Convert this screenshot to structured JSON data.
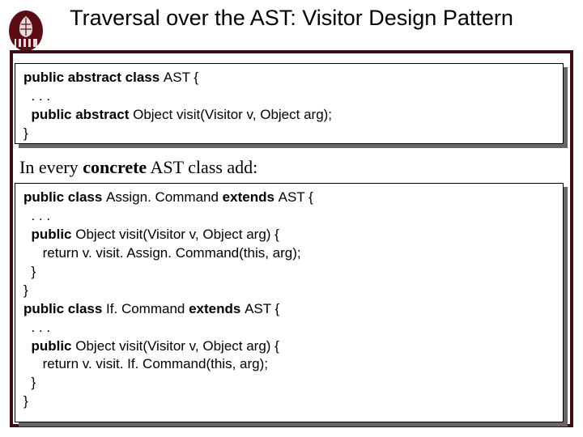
{
  "title": "Traversal over the AST: Visitor Design Pattern",
  "code1": {
    "l1a": "public abstract class ",
    "l1b": "AST {",
    "l2": "  . . .",
    "l3a": "  public abstract ",
    "l3b": "Object visit(Visitor v, Object arg);",
    "l4": "}"
  },
  "intertext": {
    "pre": "In every ",
    "bold": "concrete",
    "post": " AST class add:"
  },
  "code2": {
    "l1a": "public class ",
    "l1b": "Assign. Command ",
    "l1c": "extends ",
    "l1d": "AST {",
    "l2": "  . . .",
    "l3a": "  public ",
    "l3b": "Object visit(Visitor v, Object arg) {",
    "l4": "     return v. visit. Assign. Command(this, arg);",
    "l5": "  }",
    "l6": "}",
    "l7a": "public class ",
    "l7b": "If. Command ",
    "l7c": "extends ",
    "l7d": "AST {",
    "l8": "  . . .",
    "l9a": "  public ",
    "l9b": "Object visit(Visitor v, Object arg) {",
    "l10": "     return v. visit. If. Command(this, arg);",
    "l11": "  }",
    "l12": "}"
  }
}
